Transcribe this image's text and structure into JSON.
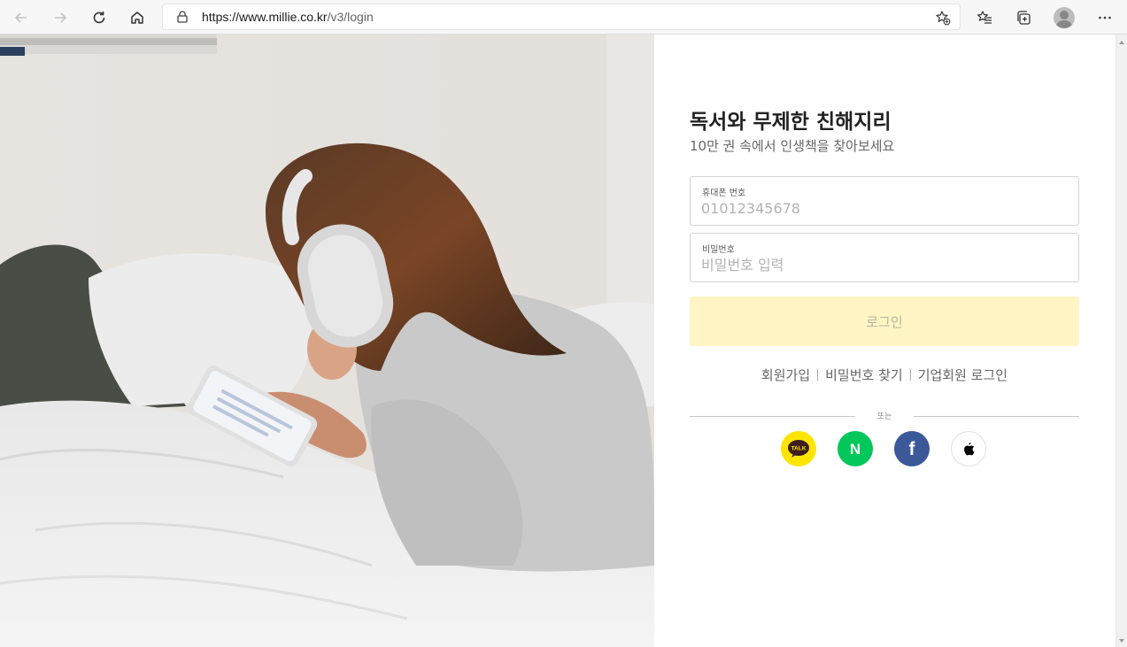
{
  "browser": {
    "url_host": "https://www.millie.co.kr",
    "url_path": "/v3/login"
  },
  "login": {
    "title": "독서와 무제한 친해지리",
    "subtitle": "10만 권 속에서 인생책을 찾아보세요",
    "phone_label": "휴대폰 번호",
    "phone_placeholder": "01012345678",
    "password_label": "비밀번호",
    "password_placeholder": "비밀번호 입력",
    "login_button": "로그인",
    "links": [
      "회원가입",
      "비밀번호 찾기",
      "기업회원 로그인"
    ],
    "divider_text": "또는",
    "kakao_text": "TALK",
    "naver_text": "N",
    "facebook_text": "f"
  },
  "colors": {
    "login_button_bg": "#fff5c4",
    "kakao": "#fee500",
    "naver": "#03c75a",
    "facebook": "#3b5998"
  },
  "icons": [
    "back-icon",
    "forward-icon",
    "refresh-icon",
    "home-icon",
    "lock-icon",
    "add-favorite-icon",
    "favorites-icon",
    "collections-icon",
    "profile-avatar",
    "more-icon",
    "kakao-icon",
    "naver-icon",
    "facebook-icon",
    "apple-icon"
  ]
}
